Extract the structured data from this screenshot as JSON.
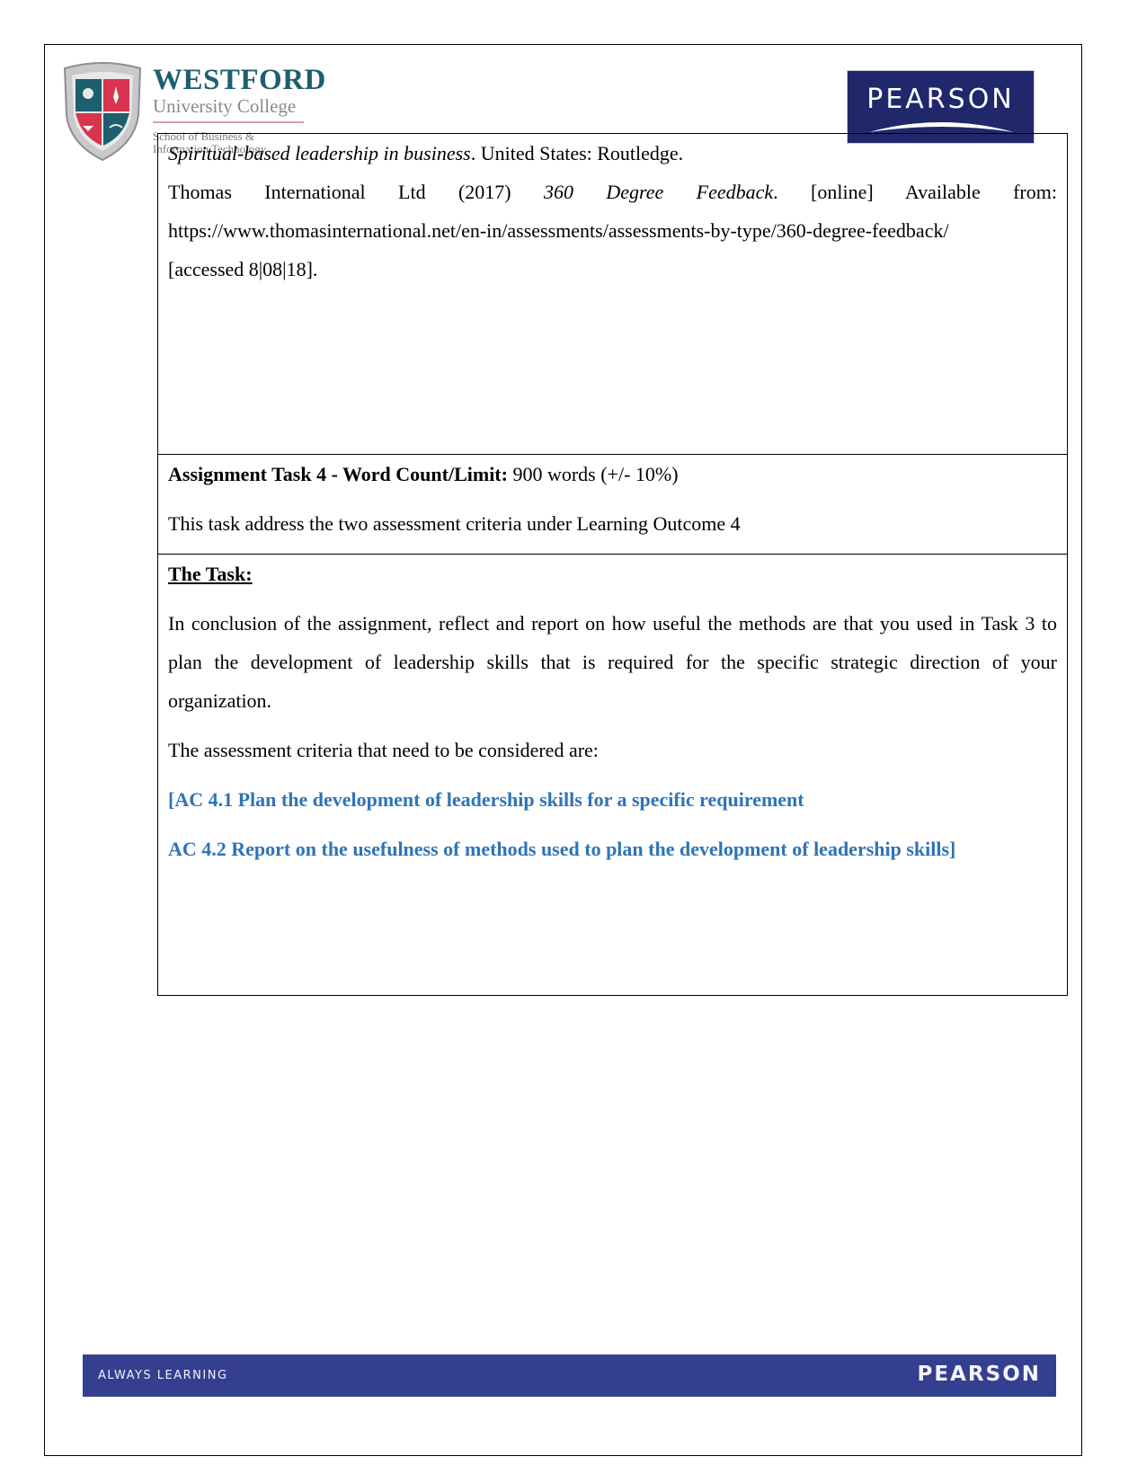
{
  "header": {
    "westford": {
      "name": "WESTFORD",
      "subtitle": "University College",
      "school_line1": "School of Business &",
      "school_line2": "Information Technology"
    },
    "pearson": {
      "name": "PEARSON"
    }
  },
  "references": {
    "line1_italic": "Spiritual-based leadership in business",
    "line1_rest": ". United States: Routledge.",
    "ref2_author": "Thomas International Ltd (2017) ",
    "ref2_title": "360 Degree Feedback",
    "ref2_rest": ". [online] Available from:",
    "ref2_url": "https://www.thomasinternational.net/en-in/assessments/assessments-by-type/360-degree-feedback/",
    "ref2_accessed": "[accessed 8|08|18]."
  },
  "word_count": {
    "label": "Assignment Task 4 - Word Count/Limit:",
    "value": " 900 words (+/- 10%)",
    "description": "This task address the two assessment criteria under Learning Outcome 4"
  },
  "task": {
    "heading": "The Task:",
    "body": "In conclusion of the assignment, reflect and report on how useful the methods are that you used in Task 3 to plan the development of leadership skills that is required for the specific strategic direction of your organization.",
    "criteria_intro": "The assessment criteria that need to be considered are:",
    "criteria": [
      "[AC 4.1 Plan the development of leadership skills for a specific requirement",
      "AC 4.2 Report on the usefulness of methods used to plan the development of leadership skills]"
    ]
  },
  "footer": {
    "left": "ALWAYS LEARNING",
    "right": "PEARSON"
  },
  "colors": {
    "criteria_blue": "#2e74b5",
    "pearson_navy": "#20276b",
    "footer_blue": "#343f8f",
    "westford_teal": "#1d5f6e"
  }
}
